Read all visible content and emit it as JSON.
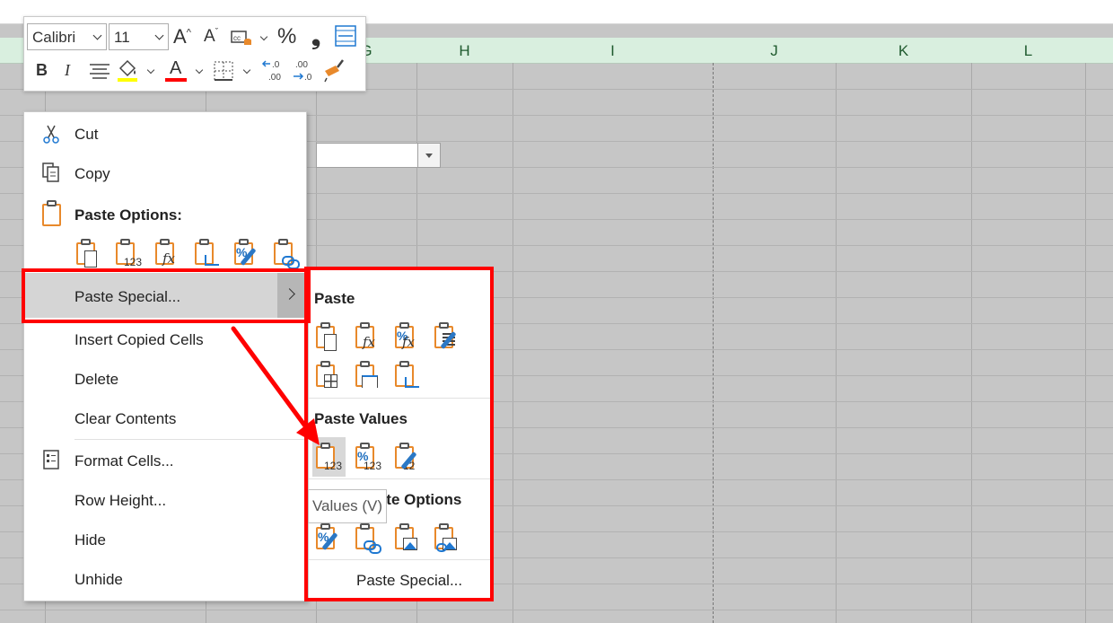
{
  "sheet": {
    "columns": [
      {
        "label": "G"
      },
      {
        "label": "H"
      },
      {
        "label": "I"
      },
      {
        "label": "J"
      },
      {
        "label": "K"
      },
      {
        "label": "L"
      }
    ]
  },
  "mini_toolbar": {
    "font_name": "Calibri",
    "font_size": "11",
    "bold": "B",
    "italic": "I",
    "percent": "%",
    "comma": "❟",
    "font_color_letter": "A",
    "highlight_color": "#ffff00",
    "font_color": "#ff0000"
  },
  "context_menu": {
    "cut": "Cut",
    "copy": "Copy",
    "paste_options": "Paste Options:",
    "paste_special": "Paste Special...",
    "insert_copied_cells": "Insert Copied Cells",
    "delete": "Delete",
    "clear_contents": "Clear Contents",
    "format_cells": "Format Cells...",
    "row_height": "Row Height...",
    "hide": "Hide",
    "unhide": "Unhide"
  },
  "submenu": {
    "paste_heading": "Paste",
    "paste_values_heading": "Paste Values",
    "other_heading": "Other Paste Options",
    "paste_special_link": "Paste Special...",
    "tooltip": "Values (V)"
  },
  "colors": {
    "annotation_red": "#ff0000",
    "clipboard_orange": "#e8892b",
    "header_green": "#d9efdf"
  }
}
